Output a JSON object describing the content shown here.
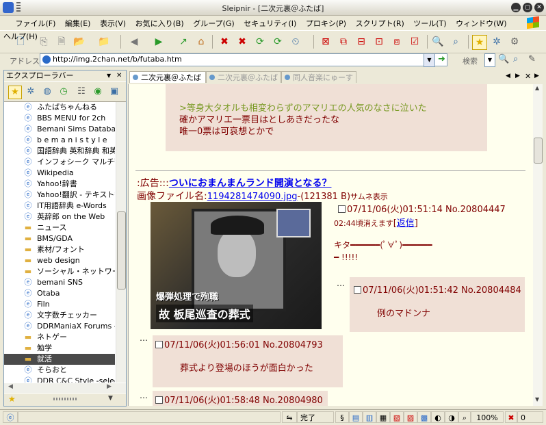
{
  "window": {
    "title": "Sleipnir - [二次元裏＠ふたば]"
  },
  "menu": [
    "ファイル(F)",
    "編集(E)",
    "表示(V)",
    "お気に入り(B)",
    "グループ(G)",
    "セキュリティ(I)",
    "プロキシ(P)",
    "スクリプト(R)",
    "ツール(T)",
    "ウィンドウ(W)",
    "ヘルプ(H)"
  ],
  "address": {
    "label": "アドレス",
    "value": "http://img.2chan.net/b/futaba.htm"
  },
  "search": {
    "label": "検索"
  },
  "explorer": {
    "title": "エクスプローラバー",
    "items": [
      {
        "label": "ふたばちゃんねる",
        "icon": "ie-page-icon"
      },
      {
        "label": "BBS MENU for 2ch",
        "icon": "ie-page-icon"
      },
      {
        "label": "Bemani Sims Database",
        "icon": "ie-page-icon"
      },
      {
        "label": "b e m a n i s t y l e",
        "icon": "ie-page-icon"
      },
      {
        "label": "国語辞典 英和辞典 和英辞典",
        "icon": "ie-page-icon"
      },
      {
        "label": "インフォシーク マルチ翻訳",
        "icon": "ie-page-icon"
      },
      {
        "label": "Wikipedia",
        "icon": "ie-page-icon"
      },
      {
        "label": "Yahoo!辞書",
        "icon": "ie-page-icon"
      },
      {
        "label": "Yahoo!翻訳 - テキスト翻訳",
        "icon": "ie-page-icon"
      },
      {
        "label": "IT用語辞典 e-Words",
        "icon": "ie-page-icon"
      },
      {
        "label": "英辞郎 on the Web",
        "icon": "ie-page-icon"
      },
      {
        "label": "ニュース",
        "icon": "folder-icon"
      },
      {
        "label": "BMS/GDA",
        "icon": "folder-icon"
      },
      {
        "label": "素材/フォント",
        "icon": "folder-icon"
      },
      {
        "label": "web design",
        "icon": "folder-icon"
      },
      {
        "label": "ソーシャル・ネットワーキング",
        "icon": "folder-icon"
      },
      {
        "label": "bemani SNS",
        "icon": "ie-page-icon"
      },
      {
        "label": "Otaba",
        "icon": "ie-page-icon"
      },
      {
        "label": "Filn",
        "icon": "ie-page-icon"
      },
      {
        "label": "文字数チェッカー",
        "icon": "ie-page-icon"
      },
      {
        "label": "DDRManiaX Forums -> Se",
        "icon": "ie-page-icon"
      },
      {
        "label": "ネトゲー",
        "icon": "folder-icon"
      },
      {
        "label": "勉学",
        "icon": "folder-icon"
      },
      {
        "label": "就活",
        "icon": "folder-icon",
        "selected": true
      },
      {
        "label": "そらおと",
        "icon": "ie-page-icon"
      },
      {
        "label": "DDR C&C Style -selection",
        "icon": "ie-page-icon"
      }
    ]
  },
  "tabs": [
    {
      "label": "二次元裏＠ふたば",
      "active": true
    },
    {
      "label": "二次元裏＠ふたば",
      "active": false
    },
    {
      "label": "同人音楽にゅーす",
      "active": false
    }
  ],
  "thread": {
    "top_reply": {
      "quote": ">等身大タオルも相変わらずのアマリエの人気のなさに泣いた",
      "line1": "確かアマリエ一票目はとしあきだったな",
      "line2": "唯一0票は可哀想とかで"
    },
    "ad_prefix": ":広告:::",
    "ad_link": "ついにおまんまんランド開演となる？",
    "image_label": "画像ファイル名:",
    "image_file": "1194281474090.jpg",
    "image_size": "-(121381 B)",
    "image_note": "サムネ表示",
    "image_caption_1": "爆弾処理で殉職",
    "image_caption_2": "故 板尾巡査の葬式",
    "op_meta": "07/11/06(火)01:51:14 No.20804447",
    "op_expire": "02:44頃消えます",
    "op_reply_link": "返信",
    "op_text_1": "キタ━━━━━━(ﾟ∀ﾟ)━━━━━━",
    "op_text_2": "━ !!!!!",
    "replies": [
      {
        "meta": "07/11/06(火)01:51:42 No.20804484",
        "text": "例のマドンナ"
      },
      {
        "meta": "07/11/06(火)01:56:01 No.20804793",
        "text": "葬式より登場のほうが面白かった"
      },
      {
        "meta": "07/11/06(火)01:58:48 No.20804980",
        "text": ""
      }
    ],
    "ellipsis": "…"
  },
  "status": {
    "text": "完了",
    "zoom": "100%",
    "errors": "0"
  }
}
